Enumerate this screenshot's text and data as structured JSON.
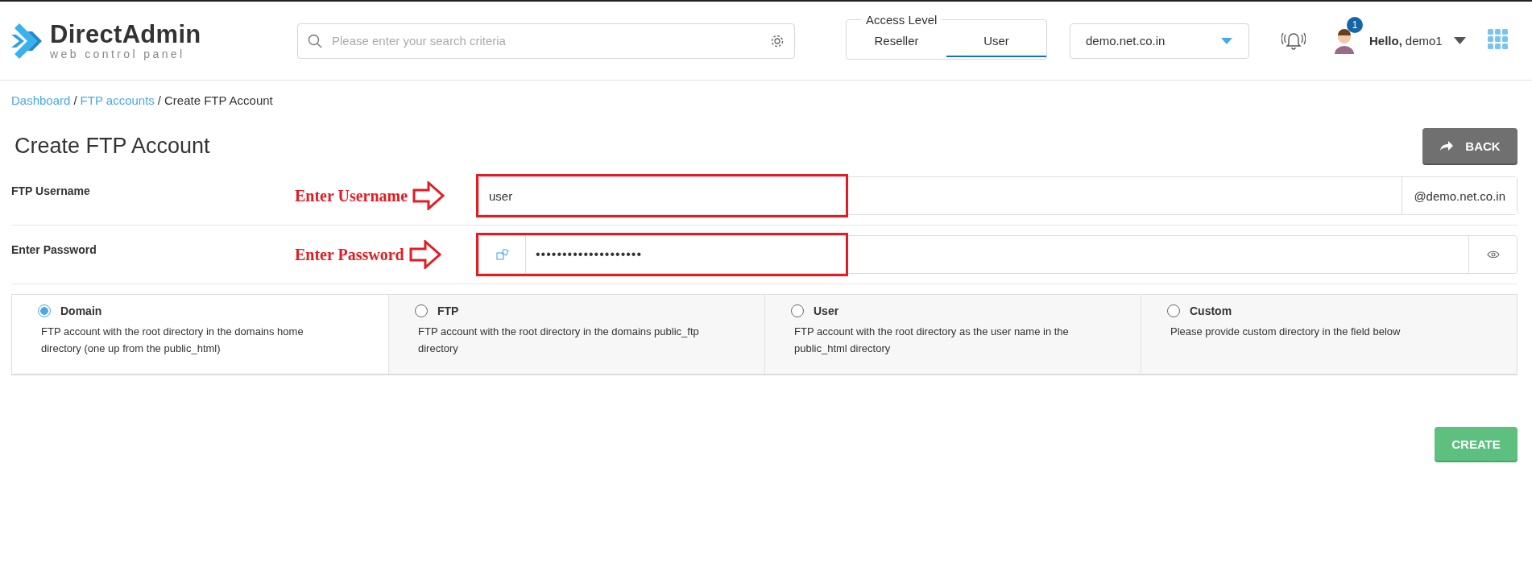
{
  "header": {
    "logo": {
      "name": "DirectAdmin",
      "tagline": "web control panel"
    },
    "search": {
      "placeholder": "Please enter your search criteria"
    },
    "access_level": {
      "title": "Access Level",
      "tabs": [
        {
          "label": "Reseller",
          "selected": false
        },
        {
          "label": "User",
          "selected": true
        }
      ]
    },
    "domain_select": {
      "value": "demo.net.co.in"
    },
    "user": {
      "badge": "1",
      "greeting": "Hello,",
      "name": "demo1"
    }
  },
  "breadcrumb": {
    "separator": "/",
    "items": [
      {
        "label": "Dashboard",
        "kind": "link"
      },
      {
        "label": "FTP accounts",
        "kind": "link"
      },
      {
        "label": "Create FTP Account",
        "kind": "current"
      }
    ]
  },
  "page_title": "Create FTP Account",
  "back_button": "BACK",
  "fields": [
    {
      "kind": "username",
      "label": "FTP Username",
      "annotation": "Enter Username",
      "value": "user",
      "suffix": "@demo.net.co.in"
    },
    {
      "kind": "password",
      "label": "Enter Password",
      "annotation": "Enter Password",
      "value": "••••••••••••••••••••"
    }
  ],
  "directory_options": [
    {
      "label": "Domain",
      "description": "FTP account with the root directory in the domains home directory (one up from the public_html)",
      "selected": true
    },
    {
      "label": "FTP",
      "description": "FTP account with the root directory in the domains public_ftp directory",
      "selected": false
    },
    {
      "label": "User",
      "description": "FTP account with the root directory as the user name in the public_html directory",
      "selected": false
    },
    {
      "label": "Custom",
      "description": "Please provide custom directory in the field below",
      "selected": false
    }
  ],
  "create_button": "CREATE"
}
